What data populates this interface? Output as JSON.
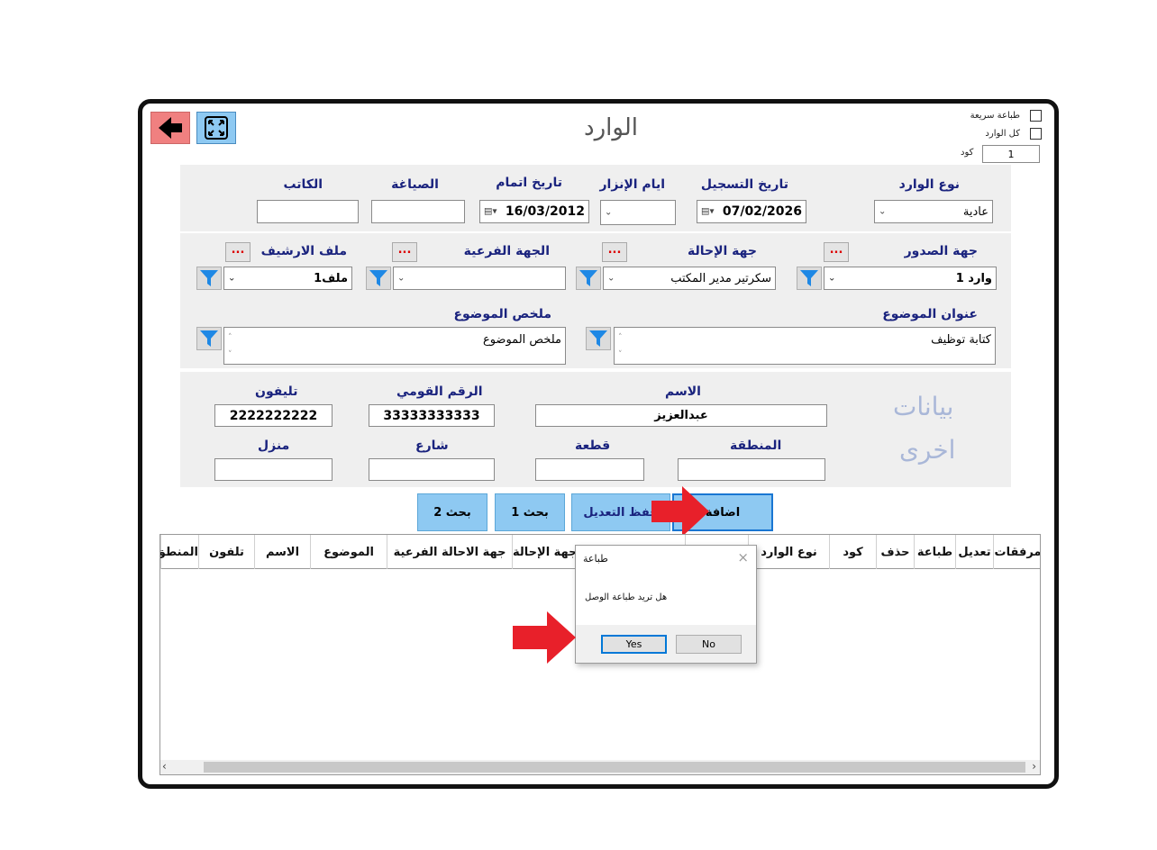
{
  "window": {
    "title": "الوارد"
  },
  "options": {
    "quick_print": "طباعة سريعة",
    "all_incoming": "كل الوارد",
    "code_label": "كود",
    "code_value": "1"
  },
  "row1": {
    "incoming_type": {
      "label": "نوع الوارد",
      "value": "عادية"
    },
    "register_date": {
      "label": "تاريخ التسجيل",
      "value": "07/02/2026"
    },
    "warning_days": {
      "label": "ايام الإنزار",
      "value": ""
    },
    "complete_date": {
      "label": "تاريخ اتمام",
      "value": "16/03/2012"
    },
    "drafting": {
      "label": "الصياغة",
      "value": ""
    },
    "writer": {
      "label": "الكاتب",
      "value": ""
    }
  },
  "row2": {
    "issuer": {
      "label": "جهة الصدور",
      "value": "وارد 1",
      "more": "..."
    },
    "referral": {
      "label": "جهة الإحالة",
      "value": "سكرتير مدير المكتب",
      "more": "..."
    },
    "sub_party": {
      "label": "الجهة الفرعية",
      "value": "",
      "more": "..."
    },
    "archive_file": {
      "label": "ملف الارشيف",
      "value": "ملف1",
      "more": "..."
    }
  },
  "row3": {
    "subject_title": {
      "label": "عنوان الموضوع",
      "value": "كتابة توظيف"
    },
    "subject_summary": {
      "label": "ملخص الموضوع",
      "value": "ملخص الموضوع"
    }
  },
  "other": {
    "heading_line1": "بيانات",
    "heading_line2": "اخرى",
    "name": {
      "label": "الاسم",
      "value": "عبدالعزيز"
    },
    "national_id": {
      "label": "الرقم القومي",
      "value": "33333333333"
    },
    "phone": {
      "label": "تليفون",
      "value": "2222222222"
    },
    "region": {
      "label": "المنطقة",
      "value": ""
    },
    "plot": {
      "label": "قطعة",
      "value": ""
    },
    "street": {
      "label": "شارع",
      "value": ""
    },
    "house": {
      "label": "منزل",
      "value": ""
    }
  },
  "actions": {
    "add": "اضافة",
    "save_edit": "حفظ التعديل",
    "search1": "بحث 1",
    "search2": "بحث 2"
  },
  "table": {
    "columns": [
      "مرفقات",
      "تعديل",
      "طباعة",
      "حذف",
      "كود",
      "نوع الوارد",
      "",
      "جهة الإحالة",
      "جهة الاحالة الفرعية",
      "الموضوع",
      "الاسم",
      "تلفون",
      "المنطق"
    ]
  },
  "dialog": {
    "title": "طباعة",
    "message": "هل تريد طباعة الوصل",
    "yes": "Yes",
    "no": "No"
  },
  "colors": {
    "accent_button": "#8ec9f2",
    "label_text": "#1a237e",
    "arrow_red": "#e8202a",
    "back_button": "#f08080"
  }
}
